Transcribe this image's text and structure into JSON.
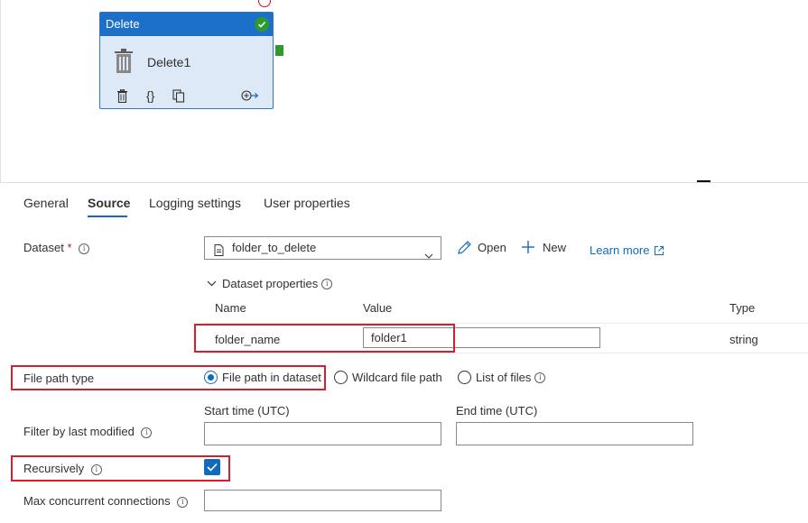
{
  "activity": {
    "header": "Delete",
    "name": "Delete1"
  },
  "tabs": [
    "General",
    "Source",
    "Logging settings",
    "User properties"
  ],
  "source": {
    "dataset_label": "Dataset",
    "dataset_required": "*",
    "dataset_value": "folder_to_delete",
    "open_label": "Open",
    "new_label": "New",
    "learn_more_label": "Learn more",
    "dataset_properties_label": "Dataset properties",
    "table": {
      "col_name": "Name",
      "col_value": "Value",
      "col_type": "Type",
      "row_name": "folder_name",
      "row_value": "folder1",
      "row_type": "string"
    },
    "file_path_type_label": "File path type",
    "file_path_options": [
      "File path in dataset",
      "Wildcard file path",
      "List of files"
    ],
    "file_path_selected": 0,
    "filter_label": "Filter by last modified",
    "start_time_label": "Start time (UTC)",
    "end_time_label": "End time (UTC)",
    "recursively_label": "Recursively",
    "recursively_checked": true,
    "max_conn_label": "Max concurrent connections"
  },
  "colors": {
    "accent": "#0f6cbd",
    "activity_header": "#1c70c8",
    "success": "#2e9a2e",
    "highlight": "#d1202e"
  }
}
